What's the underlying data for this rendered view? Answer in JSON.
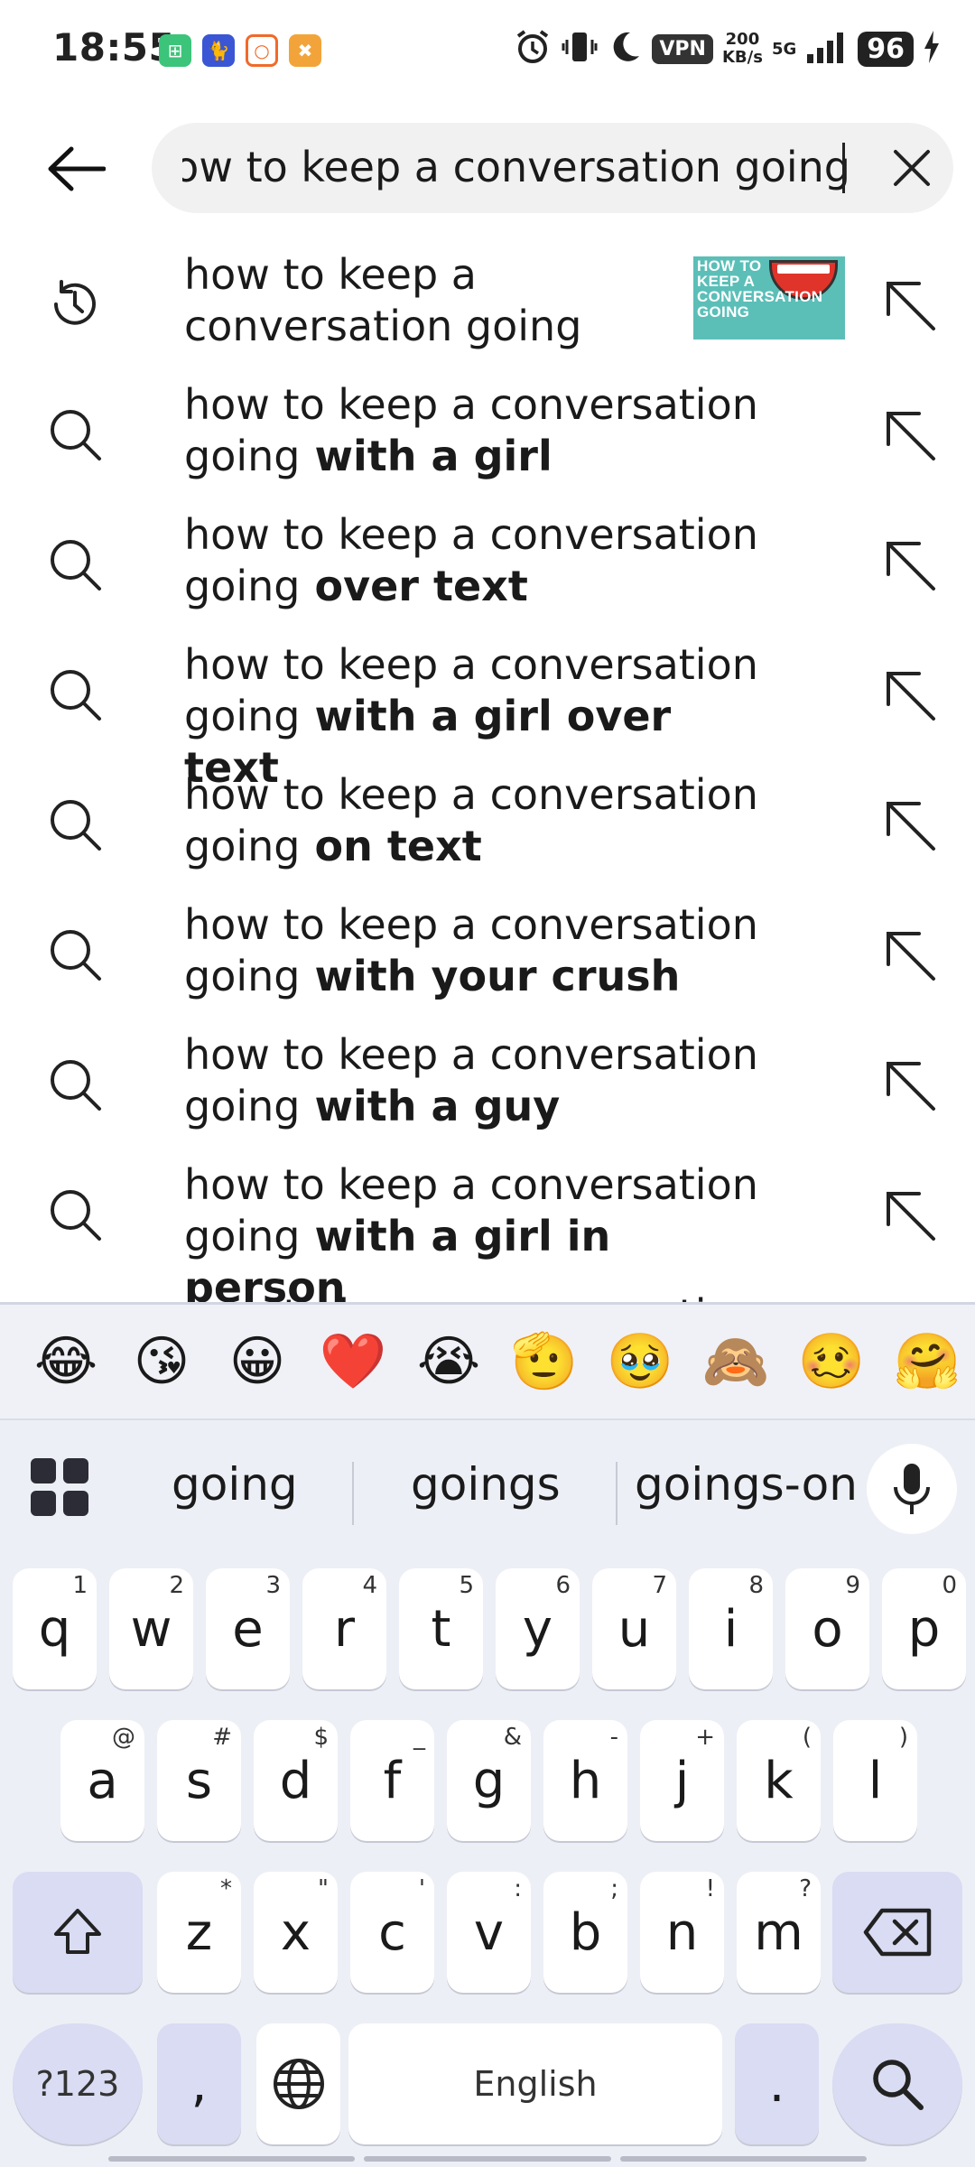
{
  "status": {
    "time": "18:55",
    "notif_icons": [
      {
        "name": "app-green-icon",
        "color": "#3cc47a",
        "glyph": "⊞"
      },
      {
        "name": "app-cat-icon",
        "color": "#3a56d4",
        "glyph": "🐈"
      },
      {
        "name": "app-ring-icon",
        "color": "#ffffff",
        "glyph": "○"
      },
      {
        "name": "app-tools-icon",
        "color": "#f2a43a",
        "glyph": "✖"
      }
    ],
    "vpn": "VPN",
    "speed_value": "200",
    "speed_unit": "KB/s",
    "network": "5G",
    "battery": "96"
  },
  "search": {
    "query": "how to keep a conversation going",
    "back_icon": "arrow-left-icon",
    "clear_icon": "close-icon"
  },
  "suggestions": [
    {
      "icon": "history-icon",
      "prefix": "how to keep a conversation going",
      "suffix": "",
      "has_thumb": true,
      "thumb_text": "HOW TO KEEP A CONVERSATION GOING"
    },
    {
      "icon": "search-icon",
      "prefix": "how to keep a conversation going",
      "suffix": " with a girl"
    },
    {
      "icon": "search-icon",
      "prefix": "how to keep a conversation going",
      "suffix": " over text"
    },
    {
      "icon": "search-icon",
      "prefix": "how to keep a conversation going",
      "suffix": " with a girl over text"
    },
    {
      "icon": "search-icon",
      "prefix": "how to keep a conversation going",
      "suffix": " on text"
    },
    {
      "icon": "search-icon",
      "prefix": "how to keep a conversation going",
      "suffix": " with your crush"
    },
    {
      "icon": "search-icon",
      "prefix": "how to keep a conversation going",
      "suffix": " with a guy"
    },
    {
      "icon": "search-icon",
      "prefix": "how to keep a conversation going",
      "suffix": " with a girl in person"
    },
    {
      "icon": "search-icon",
      "prefix": "how to keep a conversation going",
      "suffix": ""
    }
  ],
  "keyboard": {
    "emojis": [
      "😂",
      "😘",
      "😀",
      "❤️",
      "😭",
      "🫡",
      "🥹",
      "🙈",
      "🥴",
      "🤗"
    ],
    "candidates": [
      "going",
      "goings",
      "goings-on"
    ],
    "row1": [
      [
        "q",
        "1"
      ],
      [
        "w",
        "2"
      ],
      [
        "e",
        "3"
      ],
      [
        "r",
        "4"
      ],
      [
        "t",
        "5"
      ],
      [
        "y",
        "6"
      ],
      [
        "u",
        "7"
      ],
      [
        "i",
        "8"
      ],
      [
        "o",
        "9"
      ],
      [
        "p",
        "0"
      ]
    ],
    "row2": [
      [
        "a",
        "@"
      ],
      [
        "s",
        "#"
      ],
      [
        "d",
        "$"
      ],
      [
        "f",
        "_"
      ],
      [
        "g",
        "&"
      ],
      [
        "h",
        "-"
      ],
      [
        "j",
        "+"
      ],
      [
        "k",
        "("
      ],
      [
        "l",
        ")"
      ]
    ],
    "row3": [
      [
        "z",
        "*"
      ],
      [
        "x",
        "\""
      ],
      [
        "c",
        "'"
      ],
      [
        "v",
        ":"
      ],
      [
        "b",
        ";"
      ],
      [
        "n",
        "!"
      ],
      [
        "m",
        "?"
      ]
    ],
    "symbols_label": "?123",
    "comma_label": ",",
    "space_label": "English",
    "period_label": "."
  }
}
